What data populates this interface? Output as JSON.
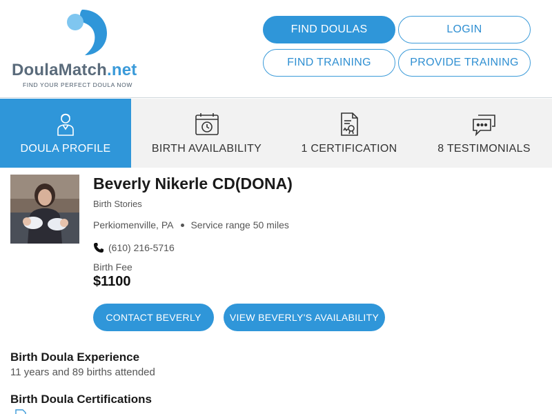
{
  "brand": {
    "name_main": "DoulaMatch",
    "name_suffix": ".net",
    "tagline": "FIND YOUR PERFECT DOULA NOW",
    "primary_color": "#2f96d9"
  },
  "nav": {
    "find_doulas": "FIND DOULAS",
    "login": "LOGIN",
    "find_training": "FIND TRAINING",
    "provide_training": "PROVIDE TRAINING"
  },
  "tabs": [
    {
      "label": "DOULA PROFILE",
      "icon": "person-icon",
      "active": true
    },
    {
      "label": "BIRTH AVAILABILITY",
      "icon": "calendar-clock-icon",
      "active": false
    },
    {
      "label": "1 CERTIFICATION",
      "icon": "certificate-icon",
      "active": false
    },
    {
      "label": "8 TESTIMONIALS",
      "icon": "chat-bubbles-icon",
      "active": false
    }
  ],
  "profile": {
    "name": "Beverly Nikerle CD(DONA)",
    "birth_stories": "Birth Stories",
    "location": "Perkiomenville, PA",
    "service_range": "Service range 50 miles",
    "phone": "(610) 216-5716",
    "fee_label": "Birth Fee",
    "fee_value": "$1100",
    "contact_button": "CONTACT BEVERLY",
    "availability_button": "VIEW BEVERLY'S AVAILABILITY"
  },
  "sections": {
    "experience_title": "Birth Doula Experience",
    "experience_text": "11 years and 89 births attended",
    "certifications_title": "Birth Doula Certifications"
  }
}
